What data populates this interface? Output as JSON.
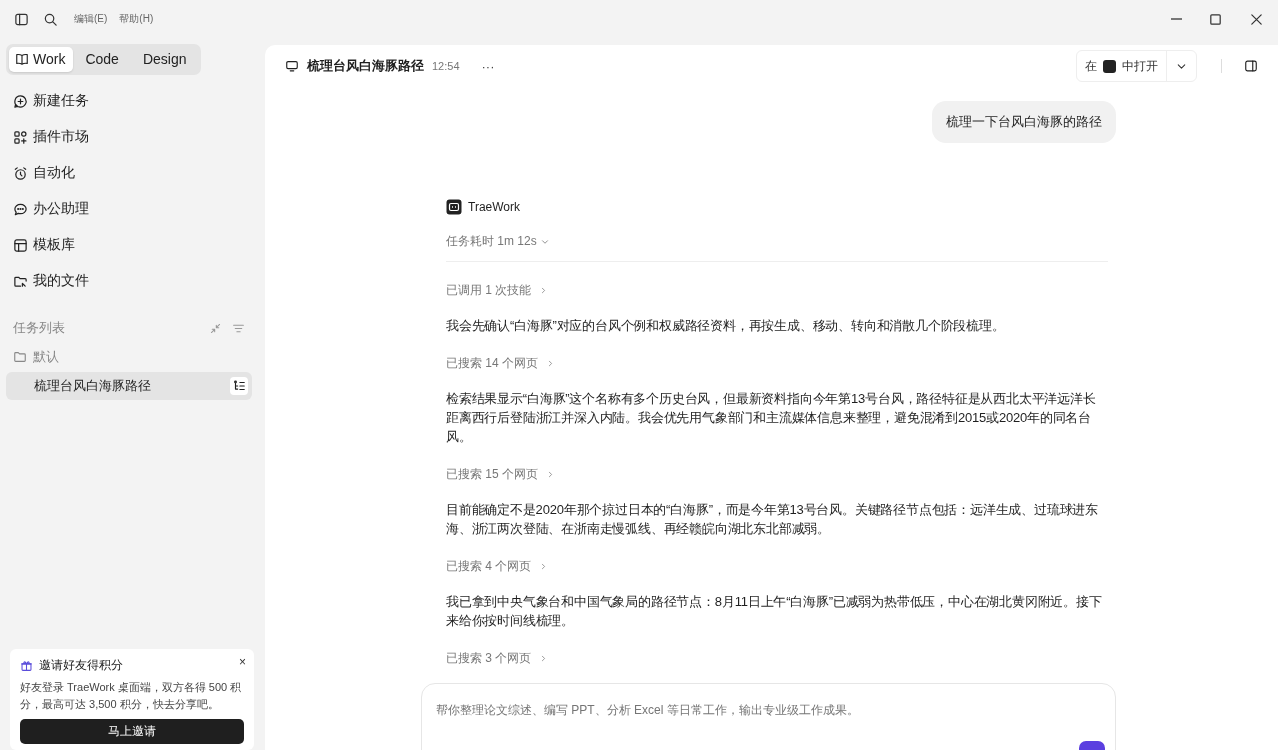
{
  "menu": [
    "编辑(E)",
    "帮助(H)"
  ],
  "modes": [
    {
      "label": "Work",
      "selected": true
    },
    {
      "label": "Code",
      "selected": false
    },
    {
      "label": "Design",
      "selected": false
    }
  ],
  "nav": [
    {
      "label": "新建任务"
    },
    {
      "label": "插件市场"
    },
    {
      "label": "自动化"
    },
    {
      "label": "办公助理"
    },
    {
      "label": "模板库"
    },
    {
      "label": "我的文件"
    }
  ],
  "task_list": {
    "title": "任务列表",
    "folder": "默认",
    "tasks": [
      {
        "label": "梳理台风白海豚路径",
        "selected": true
      }
    ]
  },
  "invite": {
    "title": "邀请好友得积分",
    "close": "×",
    "text": "好友登录 TraeWork 桌面端，双方各得 500 积分，最高可达 3,500 积分，快去分享吧。",
    "button": "马上邀请"
  },
  "chat": {
    "title": "梳理台风白海豚路径",
    "time": "12:54",
    "more": "···",
    "open_in": {
      "prefix": "在",
      "suffix": "中打开"
    },
    "user_message": "梳理一下台风白海豚的路径",
    "agent": "TraeWork",
    "duration": "任务耗时 1m 12s",
    "steps": [
      {
        "kind": "step",
        "text": "已调用 1 次技能"
      },
      {
        "kind": "text",
        "text": "我会先确认“白海豚”对应的台风个例和权威路径资料，再按生成、移动、转向和消散几个阶段梳理。"
      },
      {
        "kind": "step",
        "text": "已搜索 14 个网页"
      },
      {
        "kind": "text",
        "text": "检索结果显示“白海豚”这个名称有多个历史台风，但最新资料指向今年第13号台风，路径特征是从西北太平洋远洋长距离西行后登陆浙江并深入内陆。我会优先用气象部门和主流媒体信息来整理，避免混淆到2015或2020年的同名台风。"
      },
      {
        "kind": "step",
        "text": "已搜索 15 个网页"
      },
      {
        "kind": "text",
        "text": "目前能确定不是2020年那个掠过日本的“白海豚”，而是今年第13号台风。关键路径节点包括：远洋生成、过琉球进东海、浙江两次登陆、在浙南走慢弧线、再经赣皖向湖北东北部减弱。"
      },
      {
        "kind": "step",
        "text": "已搜索 4 个网页"
      },
      {
        "kind": "text",
        "text": "我已拿到中央气象台和中国气象局的路径节点：8月11日上午“白海豚”已减弱为热带低压，中心在湖北黄冈附近。接下来给你按时间线梳理。"
      },
      {
        "kind": "step",
        "text": "已搜索 3 个网页"
      }
    ],
    "composer": {
      "placeholder": "帮你整理论文综述、编写 PPT、分析 Excel 等日常工作，输出专业级工作成果。"
    }
  }
}
